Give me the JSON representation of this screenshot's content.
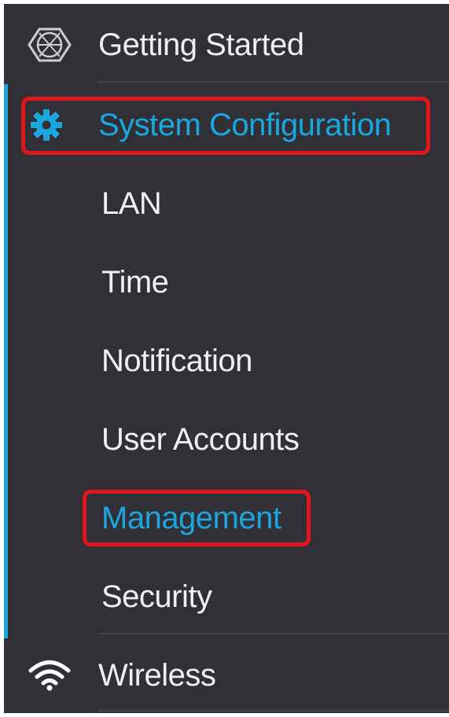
{
  "nav": {
    "getting_started": {
      "label": "Getting Started",
      "icon": "globe-icon"
    },
    "system_configuration": {
      "label": "System Configuration",
      "icon": "gear-icon",
      "active": true,
      "children": [
        {
          "label": "LAN"
        },
        {
          "label": "Time"
        },
        {
          "label": "Notification"
        },
        {
          "label": "User Accounts"
        },
        {
          "label": "Management",
          "active": true
        },
        {
          "label": "Security"
        }
      ]
    },
    "wireless": {
      "label": "Wireless",
      "icon": "wifi-icon"
    }
  },
  "colors": {
    "background": "#323037",
    "text": "#efeff1",
    "accent": "#1aa7e0",
    "highlight": "#e3161e"
  }
}
